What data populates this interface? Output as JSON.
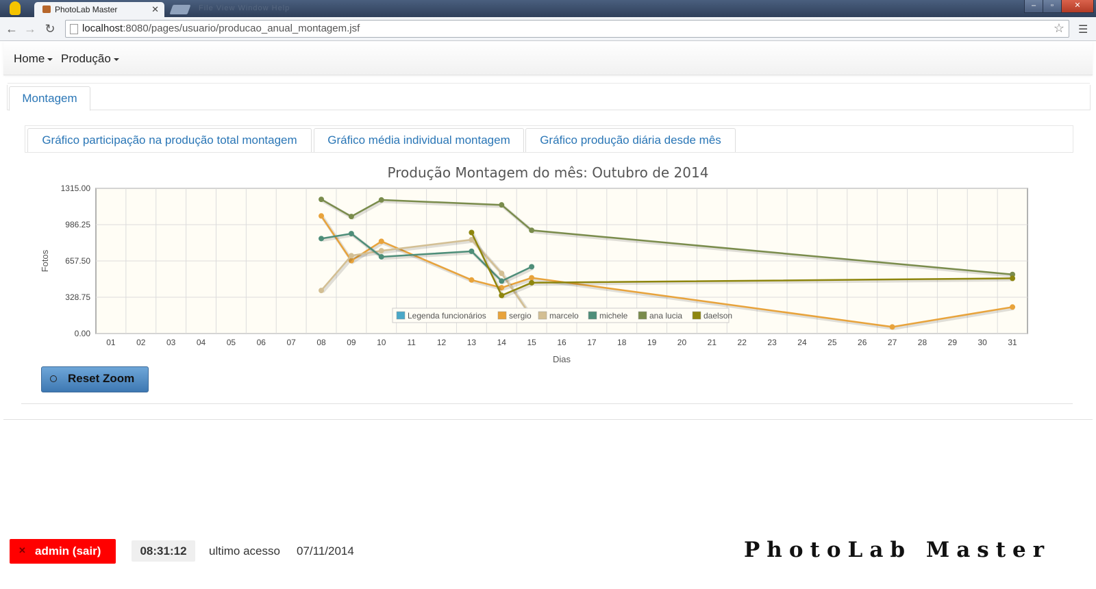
{
  "browser": {
    "tab_title": "PhotoLab Master",
    "tab_close": "✕",
    "ghost_menu": "File    View    Window    Help",
    "url_host": "localhost",
    "url_path": ":8080/pages/usuario/producao_anual_montagem.jsf",
    "controls": {
      "min": "–",
      "max": "▫",
      "close": "✕"
    }
  },
  "nav": {
    "home": "Home",
    "producao": "Produção"
  },
  "outer_tab": "Montagem",
  "inner_tabs": [
    "Gráfico participação na produção total montagem",
    "Gráfico média individual montagem",
    "Gráfico produção diária desde mês"
  ],
  "reset_zoom": "Reset Zoom",
  "footer": {
    "logout": "admin (sair)",
    "logout_icon": "✕",
    "time": "08:31:12",
    "last_access_label": "ultimo acesso",
    "last_access_date": "07/11/2014",
    "brand": "PhotoLab Master"
  },
  "chart_data": {
    "type": "line",
    "title": "Produção Montagem do mês: Outubro de 2014",
    "xlabel": "Dias",
    "ylabel": "Fotos",
    "categories": [
      "01",
      "02",
      "03",
      "04",
      "05",
      "06",
      "07",
      "08",
      "09",
      "10",
      "11",
      "12",
      "13",
      "14",
      "15",
      "16",
      "17",
      "18",
      "19",
      "20",
      "21",
      "22",
      "23",
      "24",
      "25",
      "26",
      "27",
      "28",
      "29",
      "30",
      "31"
    ],
    "yticks": [
      "0.00",
      "328.75",
      "657.50",
      "986.25",
      "1315.00"
    ],
    "ylim": [
      0,
      1315
    ],
    "grid": true,
    "legend_position": "bottom-center",
    "legend_title": "Legenda funcionários",
    "series": [
      {
        "name": "sergio",
        "color": "#e8a33b",
        "points": [
          [
            "08",
            1065
          ],
          [
            "09",
            660
          ],
          [
            "10",
            835
          ],
          [
            "13",
            485
          ],
          [
            "14",
            415
          ],
          [
            "15",
            505
          ],
          [
            "27",
            60
          ],
          [
            "31",
            240
          ]
        ]
      },
      {
        "name": "marcelo",
        "color": "#d3bf93",
        "points": [
          [
            "08",
            390
          ],
          [
            "09",
            705
          ],
          [
            "10",
            750
          ],
          [
            "13",
            850
          ],
          [
            "14",
            545
          ],
          [
            "15",
            150
          ]
        ]
      },
      {
        "name": "michele",
        "color": "#4e8e79",
        "points": [
          [
            "08",
            860
          ],
          [
            "09",
            905
          ],
          [
            "10",
            695
          ],
          [
            "13",
            745
          ],
          [
            "14",
            475
          ],
          [
            "15",
            605
          ]
        ]
      },
      {
        "name": "ana lucia",
        "color": "#7a8c4c",
        "points": [
          [
            "08",
            1215
          ],
          [
            "09",
            1060
          ],
          [
            "10",
            1210
          ],
          [
            "14",
            1165
          ],
          [
            "15",
            935
          ],
          [
            "31",
            535
          ]
        ]
      },
      {
        "name": "daelson",
        "color": "#8e860e",
        "points": [
          [
            "13",
            915
          ],
          [
            "14",
            345
          ],
          [
            "15",
            460
          ],
          [
            "31",
            500
          ]
        ]
      }
    ]
  }
}
